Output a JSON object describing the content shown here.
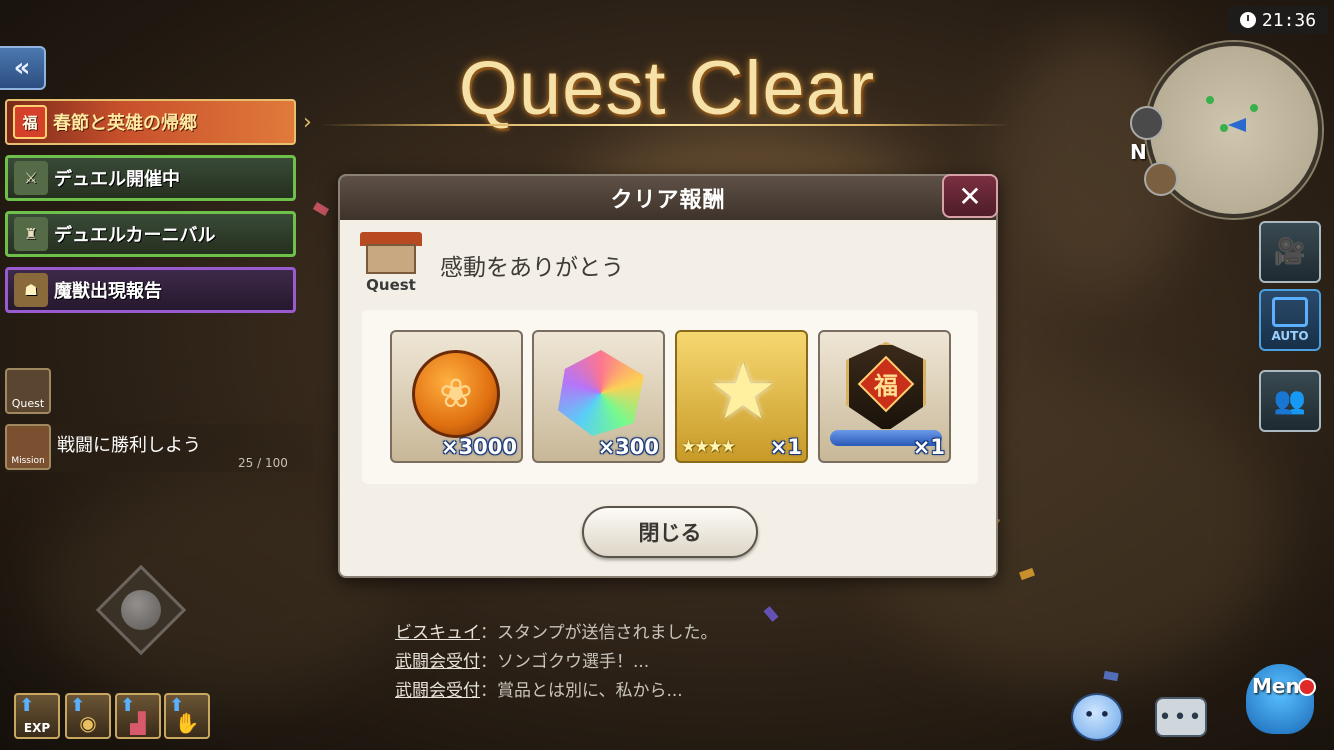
{
  "title": "Quest Clear",
  "clock": "21:36",
  "compass": "N",
  "events": [
    {
      "label": "春節と英雄の帰郷",
      "icon_glyph": "福"
    },
    {
      "label": "デュエル開催中",
      "icon_glyph": "⚔"
    },
    {
      "label": "デュエルカーニバル",
      "icon_glyph": "♜"
    },
    {
      "label": "魔獣出現報告",
      "icon_glyph": "☗"
    }
  ],
  "sidebar": {
    "quest_tile_label": "Quest",
    "mission_tile_label": "Mission",
    "mission_text": "戦闘に勝利しよう",
    "mission_progress": "25 / 100"
  },
  "skills": {
    "exp_label": "EXP"
  },
  "dialog": {
    "header": "クリア報酬",
    "quest_label": "Quest",
    "message": "感動をありがとう",
    "close_button": "閉じる",
    "rewards": [
      {
        "icon": "gold-knot-coin-icon",
        "quantity": "×3000"
      },
      {
        "icon": "rainbow-crystal-icon",
        "quantity": "×300"
      },
      {
        "icon": "star-gem-icon",
        "stars": "★★★★",
        "quantity": "×1"
      },
      {
        "icon": "fortune-emblem-icon",
        "glyph": "福",
        "quantity": "×1"
      }
    ]
  },
  "chat": [
    {
      "who": "ビスキュイ",
      "text": "：スタンプが送信されました。"
    },
    {
      "who": "武闘会受付",
      "text": "：ソンゴクウ選手！..."
    },
    {
      "who": "武闘会受付",
      "text": "：賞品とは別に、私から..."
    }
  ],
  "right_buttons": {
    "auto_label": "AUTO",
    "menu_label": "Menu"
  }
}
